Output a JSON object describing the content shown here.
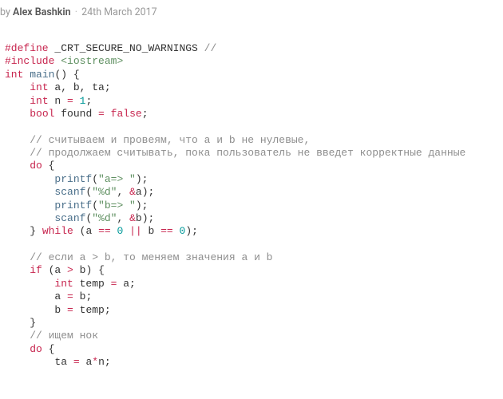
{
  "meta": {
    "by": "by",
    "author": "Alex Bashkin",
    "dot": "·",
    "date": "24th March 2017"
  },
  "code": {
    "l0_a": "#define",
    "l0_b": "_CRT_SECURE_NO_WARNINGS",
    "l0_c": "//",
    "l1_a": "#include",
    "l1_b": "<iostream>",
    "l2_a": "int",
    "l2_b": "main",
    "l2_c": "() {",
    "l3_a": "int",
    "l3_b": " a, b, ta;",
    "l4_a": "int",
    "l4_b": " n ",
    "l4_c": "=",
    "l4_d": " ",
    "l4_e": "1",
    "l4_f": ";",
    "l5_a": "bool",
    "l5_b": " found ",
    "l5_c": "=",
    "l5_d": " ",
    "l5_e": "false",
    "l5_f": ";",
    "l6": "",
    "l7": "// считываем и провеям, что а и b не нулевые,",
    "l8": "// продолжаем считывать, пока пользователь не введет корректные данные",
    "l9_a": "do",
    "l9_b": " {",
    "l10_a": "printf",
    "l10_b": "(",
    "l10_c": "\"a=> \"",
    "l10_d": ");",
    "l11_a": "scanf",
    "l11_b": "(",
    "l11_c": "\"%d\"",
    "l11_d": ", ",
    "l11_e": "&",
    "l11_f": "a);",
    "l12_a": "printf",
    "l12_b": "(",
    "l12_c": "\"b=> \"",
    "l12_d": ");",
    "l13_a": "scanf",
    "l13_b": "(",
    "l13_c": "\"%d\"",
    "l13_d": ", ",
    "l13_e": "&",
    "l13_f": "b);",
    "l14_a": "} ",
    "l14_b": "while",
    "l14_c": " (a ",
    "l14_d": "==",
    "l14_e": " ",
    "l14_f": "0",
    "l14_g": " ",
    "l14_h": "||",
    "l14_i": " b ",
    "l14_j": "==",
    "l14_k": " ",
    "l14_l": "0",
    "l14_m": ");",
    "l15": "",
    "l16": "// если a > b, то меняем значения a и b",
    "l17_a": "if",
    "l17_b": " (a ",
    "l17_c": ">",
    "l17_d": " b) {",
    "l18_a": "int",
    "l18_b": " temp ",
    "l18_c": "=",
    "l18_d": " a;",
    "l19_a": "a ",
    "l19_b": "=",
    "l19_c": " b;",
    "l20_a": "b ",
    "l20_b": "=",
    "l20_c": " temp;",
    "l21": "}",
    "l22": "// ищем нок",
    "l23_a": "do",
    "l23_b": " {",
    "l24_a": "ta ",
    "l24_b": "=",
    "l24_c": " a",
    "l24_d": "*",
    "l24_e": "n;"
  }
}
